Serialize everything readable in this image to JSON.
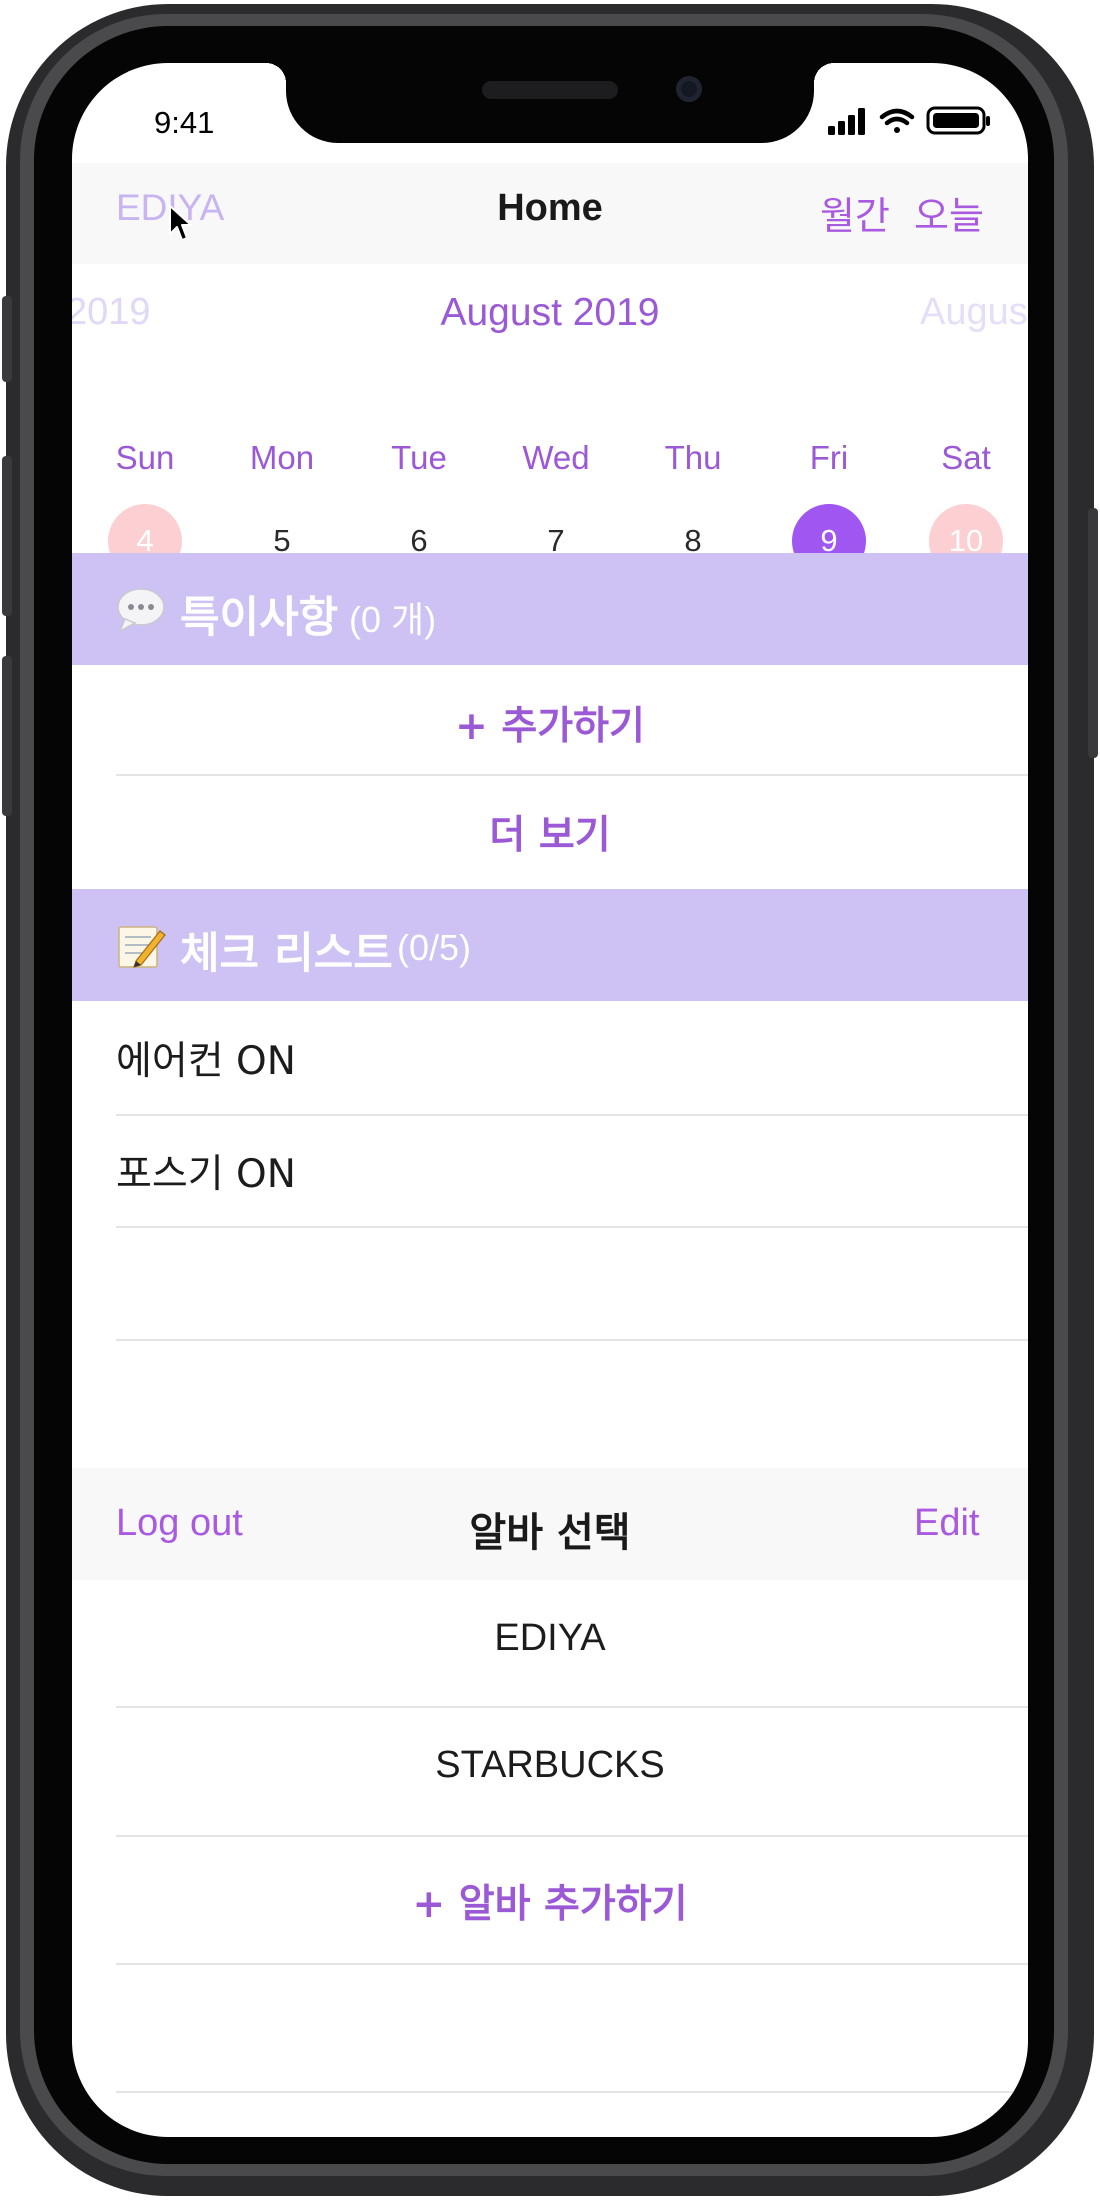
{
  "status_bar": {
    "time": "9:41"
  },
  "navbar": {
    "left_label": "EDIYA",
    "title": "Home",
    "right_monthly": "월간",
    "right_today": "오늘"
  },
  "calendar": {
    "prev_month": "2019",
    "current_month": "August 2019",
    "next_month": "Augus",
    "weekdays": [
      "Sun",
      "Mon",
      "Tue",
      "Wed",
      "Thu",
      "Fri",
      "Sat"
    ],
    "days": [
      "4",
      "5",
      "6",
      "7",
      "8",
      "9",
      "10"
    ],
    "selected_day": "9"
  },
  "notes_section": {
    "icon": "speech-bubble-icon",
    "title": "특이사항",
    "count": "(0 개)",
    "add_label": "+ 추가하기",
    "more_label": "더 보기"
  },
  "checklist_section": {
    "icon": "memo-icon",
    "title": "체크 리스트",
    "count": "(0/5)",
    "items": [
      "에어컨 ON",
      "포스기 ON"
    ]
  },
  "job_select": {
    "logout_label": "Log out",
    "title": "알바 선택",
    "edit_label": "Edit",
    "jobs": [
      "EDIYA",
      "STARBUCKS"
    ],
    "add_job_label": "+ 알바 추가하기"
  },
  "colors": {
    "accent": "#a95ae0",
    "section_header": "#cec1f3",
    "weekend_circle": "#fcd0d2",
    "selected_circle": "#a056f0"
  }
}
